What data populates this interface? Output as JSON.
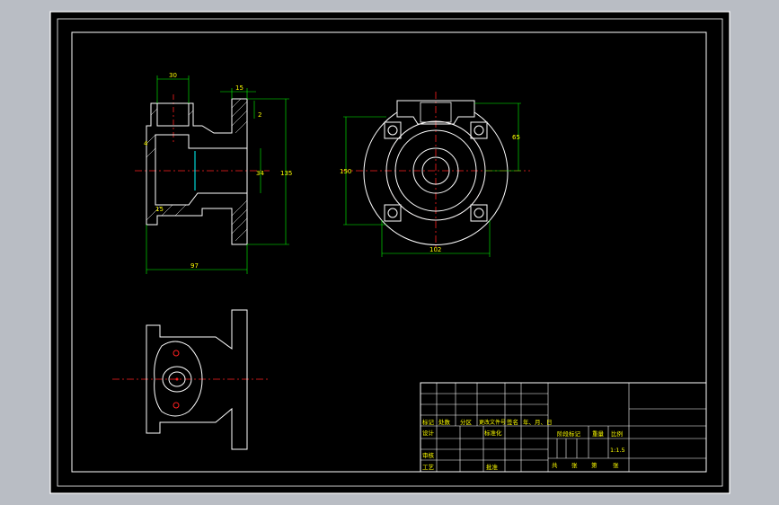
{
  "colors": {
    "background": "#b9bdc4",
    "sheet": "#000000",
    "outline": "#ffffff",
    "dimension": "#00ff00",
    "centerline": "#ff2020",
    "label": "#ffff00",
    "accent": "#00ffff"
  },
  "dims": {
    "width_top": "30",
    "flange_offset": "15",
    "flange_thk": "2",
    "bore": "34",
    "height_total": "135",
    "length_total": "97",
    "left_callout": "4",
    "lower_callout": "15",
    "circle_dia": "150",
    "tab_height": "65",
    "bolt_span": "102"
  },
  "title_block": {
    "r1": [
      "标记",
      "处数",
      "分区",
      "更改文件号",
      "签名",
      "年、月、日"
    ],
    "design": "设计",
    "standard": "标准化",
    "stage_mark": "阶段标记",
    "weight": "重量",
    "scale_label": "比例",
    "scale": "1:1.5",
    "review": "审核",
    "process": "工艺",
    "approve": "批准",
    "sheets_total": "共",
    "sheets_label_a": "张",
    "sheet_no": "第",
    "sheets_label_b": "张"
  }
}
